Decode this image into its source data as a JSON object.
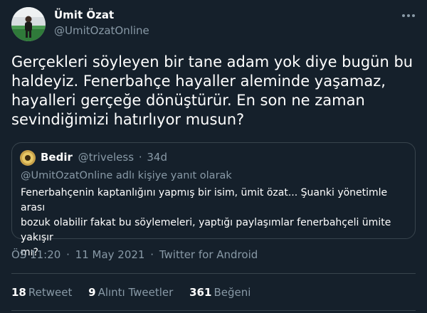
{
  "colors": {
    "background": "#15202b",
    "text": "#ffffff",
    "muted": "#8899a6",
    "border": "#38444d"
  },
  "author": {
    "name": "Ümit Özat",
    "handle": "@UmitOzatOnline",
    "avatar_icon": "profile-photo-avatar"
  },
  "more_icon": "more-dots-icon",
  "tweet": {
    "lines": [
      "Gerçekleri söyleyen bir tane adam yok diye bugün bu",
      "haldeyiz. Fenerbahçe hayaller aleminde yaşamaz,",
      "hayalleri gerçeğe dönüştürür. En son ne zaman",
      "sevindiğimizi hatırlıyor musun?"
    ]
  },
  "quote": {
    "name": "Bedir",
    "handle": "@triveless",
    "separator": "·",
    "time": "34d",
    "reply_context": "@UmitOzatOnline adlı kişiye yanıt olarak",
    "lines": [
      "Fenerbahçenin kaptanlığını yapmış bir isim, ümit özat... Şuanki yönetimle arası",
      "bozuk olabilir fakat bu söylemeleri, yaptığı paylaşımlar fenerbahçeli ümite yakışır",
      "mı?"
    ]
  },
  "meta": {
    "time": "ÖS 11:20",
    "separator": "·",
    "date": "11 May 2021",
    "source": "Twitter for Android"
  },
  "stats": {
    "retweets": {
      "count": "18",
      "label": "Retweet"
    },
    "quotes": {
      "count": "9",
      "label": "Alıntı Tweetler"
    },
    "likes": {
      "count": "361",
      "label": "Beğeni"
    }
  }
}
